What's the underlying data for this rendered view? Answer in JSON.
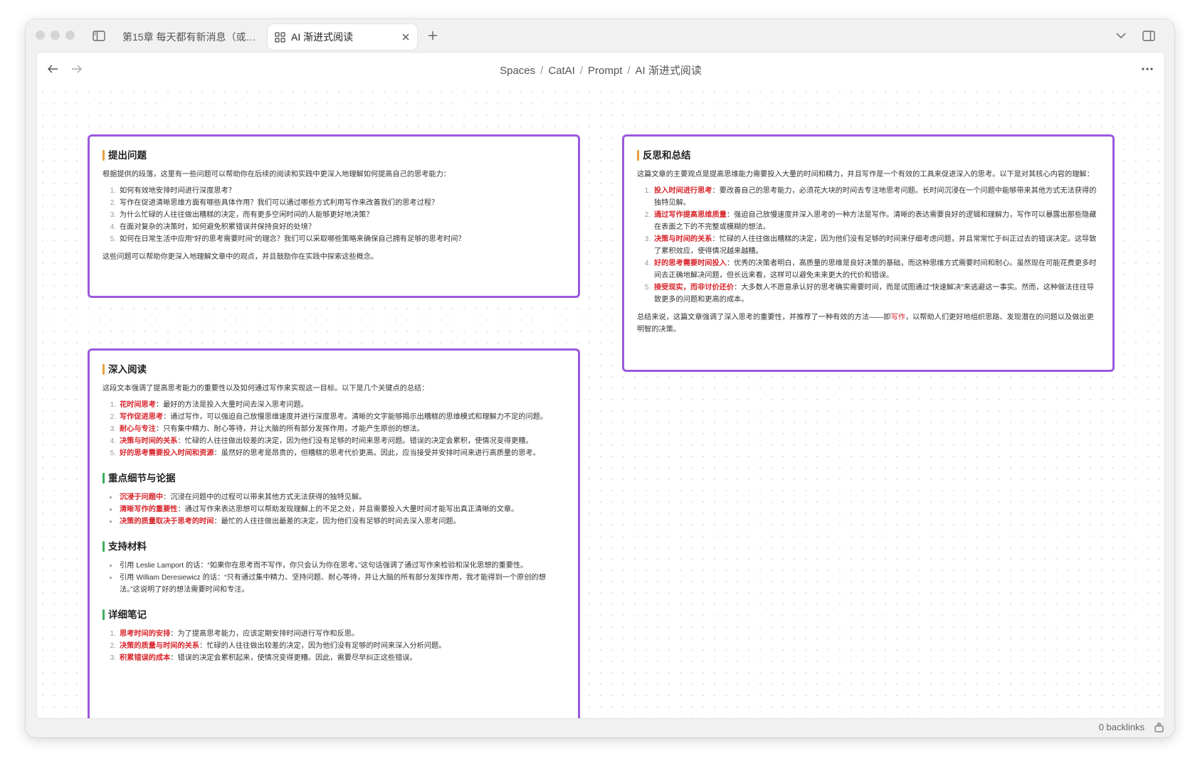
{
  "window": {
    "tabs": [
      {
        "label": "第15章 每天都有新消息（或…",
        "active": false
      },
      {
        "label": "AI 渐进式阅读",
        "active": true
      }
    ]
  },
  "breadcrumb": [
    "Spaces",
    "CatAI",
    "Prompt",
    "AI 渐进式阅读"
  ],
  "footer": {
    "backlinks": "0 backlinks"
  },
  "cards": {
    "questions": {
      "title": "提出问题",
      "intro": "根据提供的段落，这里有一些问题可以帮助你在后续的阅读和实践中更深入地理解如何提高自己的思考能力：",
      "items": [
        "如何有效地安排时间进行深度思考？",
        "写作在促进清晰思维方面有哪些具体作用？我们可以通过哪些方式利用写作来改善我们的思考过程？",
        "为什么忙碌的人往往做出糟糕的决定，而有更多空闲时间的人能够更好地决策？",
        "在面对复杂的决策时，如何避免积累错误并保持良好的处境？",
        "如何在日常生活中应用“好的思考需要时间”的理念？我们可以采取哪些策略来确保自己拥有足够的思考时间？"
      ],
      "outro": "这些问题可以帮助你更深入地理解文章中的观点，并且鼓励你在实践中探索这些概念。"
    },
    "reflection": {
      "title": "反思和总结",
      "intro": "这篇文章的主要观点是提高思维能力需要投入大量的时间和精力，并且写作是一个有效的工具来促进深入的思考。以下是对其核心内容的理解：",
      "items": [
        {
          "key": "投入时间进行思考",
          "text": "：要改善自己的思考能力，必须花大块的时间去专注地思考问题。长时间沉浸在一个问题中能够带来其他方式无法获得的独特见解。"
        },
        {
          "key": "通过写作提高思维质量",
          "text": "：强迫自己放慢速度并深入思考的一种方法是写作。清晰的表达需要良好的逻辑和理解力，写作可以暴露出那些隐藏在表面之下的不完整或模糊的想法。"
        },
        {
          "key": "决策与时间的关系",
          "text": "：忙碌的人往往做出糟糕的决定，因为他们没有足够的时间来仔细考虑问题，并且常常忙于纠正过去的错误决定。这导致了累积效应，使得情况越来越糟。"
        },
        {
          "key": "好的思考需要时间投入",
          "text": "：优秀的决策者明白，高质量的思维是良好决策的基础，而这种思维方式需要时间和耐心。虽然现在可能花费更多时间去正确地解决问题，但长远来看，这样可以避免未来更大的代价和错误。"
        },
        {
          "key": "接受现实，而非讨价还价",
          "text": "：大多数人不愿意承认好的思考确实需要时间，而是试图通过“快速解决”来逃避这一事实。然而，这种做法往往导致更多的问题和更高的成本。"
        }
      ],
      "outro_before": "总结来说，这篇文章强调了深入思考的重要性，并推荐了一种有效的方法——即",
      "outro_hl": "写作",
      "outro_after": "，以帮助人们更好地组织思路、发现潜在的问题以及做出更明智的决策。"
    },
    "deep": {
      "title": "深入阅读",
      "intro": "这段文本强调了提高思考能力的重要性以及如何通过写作来实现这一目标。以下是几个关键点的总结：",
      "items": [
        {
          "key": "花时间思考",
          "text": "：最好的方法是投入大量时间去深入思考问题。"
        },
        {
          "key": "写作促进思考",
          "text": "：通过写作，可以强迫自己放慢思维速度并进行深度思考。清晰的文字能够揭示出糟糕的思维模式和理解力不足的问题。"
        },
        {
          "key": "耐心与专注",
          "text": "：只有集中精力、耐心等待，并让大脑的所有部分发挥作用，才能产生原创的想法。"
        },
        {
          "key": "决策与时间的关系",
          "text": "：忙碌的人往往做出较差的决定，因为他们没有足够的时间来思考问题。错误的决定会累积，使情况变得更糟。"
        },
        {
          "key": "好的思考需要投入时间和资源",
          "text": "：虽然好的思考是昂贵的，但糟糕的思考代价更高。因此，应当接受并安排时间来进行高质量的思考。"
        }
      ],
      "details_title": "重点细节与论据",
      "details": [
        {
          "key": "沉浸于问题中",
          "text": "：沉浸在问题中的过程可以带来其他方式无法获得的独特见解。"
        },
        {
          "key": "清晰写作的重要性",
          "text": "：通过写作来表达思想可以帮助发现理解上的不足之处，并且需要投入大量时间才能写出真正清晰的文章。"
        },
        {
          "key": "决策的质量取决于思考的时间",
          "text": "：最忙的人往往做出最差的决定，因为他们没有足够的时间去深入思考问题。"
        }
      ],
      "support_title": "支持材料",
      "support": [
        "引用 Leslie Lamport 的话：“如果你在思考而不写作，你只会认为你在思考。”这句话强调了通过写作来检验和深化思想的重要性。",
        "引用 William Deresiewicz 的话：“只有通过集中精力、坚持问题、耐心等待，并让大脑的所有部分发挥作用，我才能得到一个原创的想法。”这说明了好的想法需要时间和专注。"
      ],
      "notes_title": "详细笔记",
      "notes": [
        {
          "key": "思考时间的安排",
          "text": "：为了提高思考能力，应该定期安排时间进行写作和反思。"
        },
        {
          "key": "决策的质量与时间的关系",
          "text": "：忙碌的人往往做出较差的决定，因为他们没有足够的时间来深入分析问题。"
        },
        {
          "key": "积累错误的成本",
          "text": "：错误的决定会累积起来，使情况变得更糟。因此，需要尽早纠正这些错误。"
        }
      ]
    }
  }
}
